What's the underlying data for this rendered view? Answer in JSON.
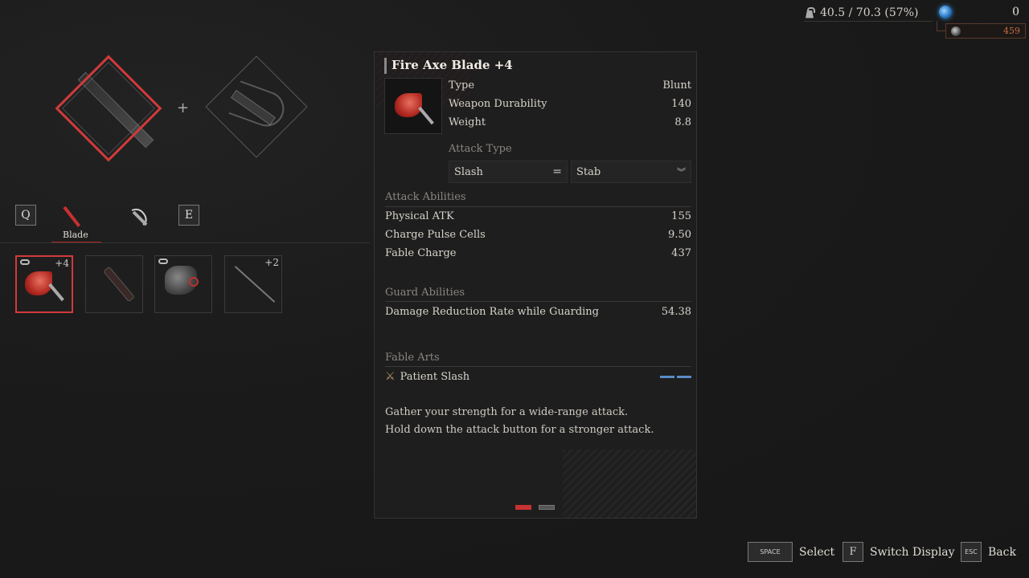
{
  "hud": {
    "weight_icon": "weight-icon",
    "weight": "40.5 / 70.3 (57%)",
    "primary_currency_icon": "blue-orb-icon",
    "primary_currency": "0",
    "secondary_currency_icon": "grey-orb-icon",
    "secondary_currency": "459"
  },
  "assembly": {
    "plus": "+",
    "blade_slot": "blade-diamond-slot",
    "handle_slot": "handle-diamond-slot"
  },
  "category_tabs": {
    "prev_key": "Q",
    "next_key": "E",
    "tabs": [
      {
        "label": "Blade",
        "icon": "blade-icon",
        "active": true
      },
      {
        "label": "",
        "icon": "handle-icon",
        "active": false
      }
    ]
  },
  "inventory": {
    "slots": [
      {
        "name": "Fire Axe Blade",
        "level": "+4",
        "linked": true,
        "selected": true
      },
      {
        "name": "Knife Blade",
        "level": "",
        "linked": false,
        "selected": false
      },
      {
        "name": "Gauntlet Blade",
        "level": "",
        "linked": true,
        "selected": false
      },
      {
        "name": "Rod Blade",
        "level": "+2",
        "linked": false,
        "selected": false
      }
    ]
  },
  "detail": {
    "title": "Fire Axe Blade +4",
    "stats": [
      {
        "label": "Type",
        "value": "Blunt"
      },
      {
        "label": "Weapon Durability",
        "value": "140"
      },
      {
        "label": "Weight",
        "value": "8.8"
      }
    ],
    "attack_type": {
      "label": "Attack Type",
      "primary": "Slash",
      "secondary": "Stab"
    },
    "attack_abilities": {
      "label": "Attack Abilities",
      "rows": [
        {
          "label": "Physical ATK",
          "value": "155"
        },
        {
          "label": "Charge Pulse Cells",
          "value": "9.50"
        },
        {
          "label": "Fable Charge",
          "value": "437"
        }
      ]
    },
    "guard_abilities": {
      "label": "Guard Abilities",
      "rows": [
        {
          "label": "Damage Reduction Rate while Guarding",
          "value": "54.38"
        }
      ]
    },
    "fable_arts": {
      "label": "Fable Arts",
      "art_name": "Patient Slash",
      "art_icon": "crossed-swords-icon",
      "gauge_segments": 2
    },
    "description": [
      "Gather your strength for a wide-range attack.",
      "Hold down the attack button for a stronger attack."
    ],
    "page": {
      "current": 1,
      "total": 2
    }
  },
  "hints": [
    {
      "key": "SPACE",
      "label": "Select"
    },
    {
      "key": "F",
      "label": "Switch Display"
    },
    {
      "key": "ESC",
      "label": "Back"
    }
  ],
  "colors": {
    "accent_red": "#d23a3a",
    "background": "#1a1a1a",
    "panel": "#1e1e1e",
    "gauge_blue": "#5a8ac8",
    "secondary_currency": "#c86a44"
  }
}
